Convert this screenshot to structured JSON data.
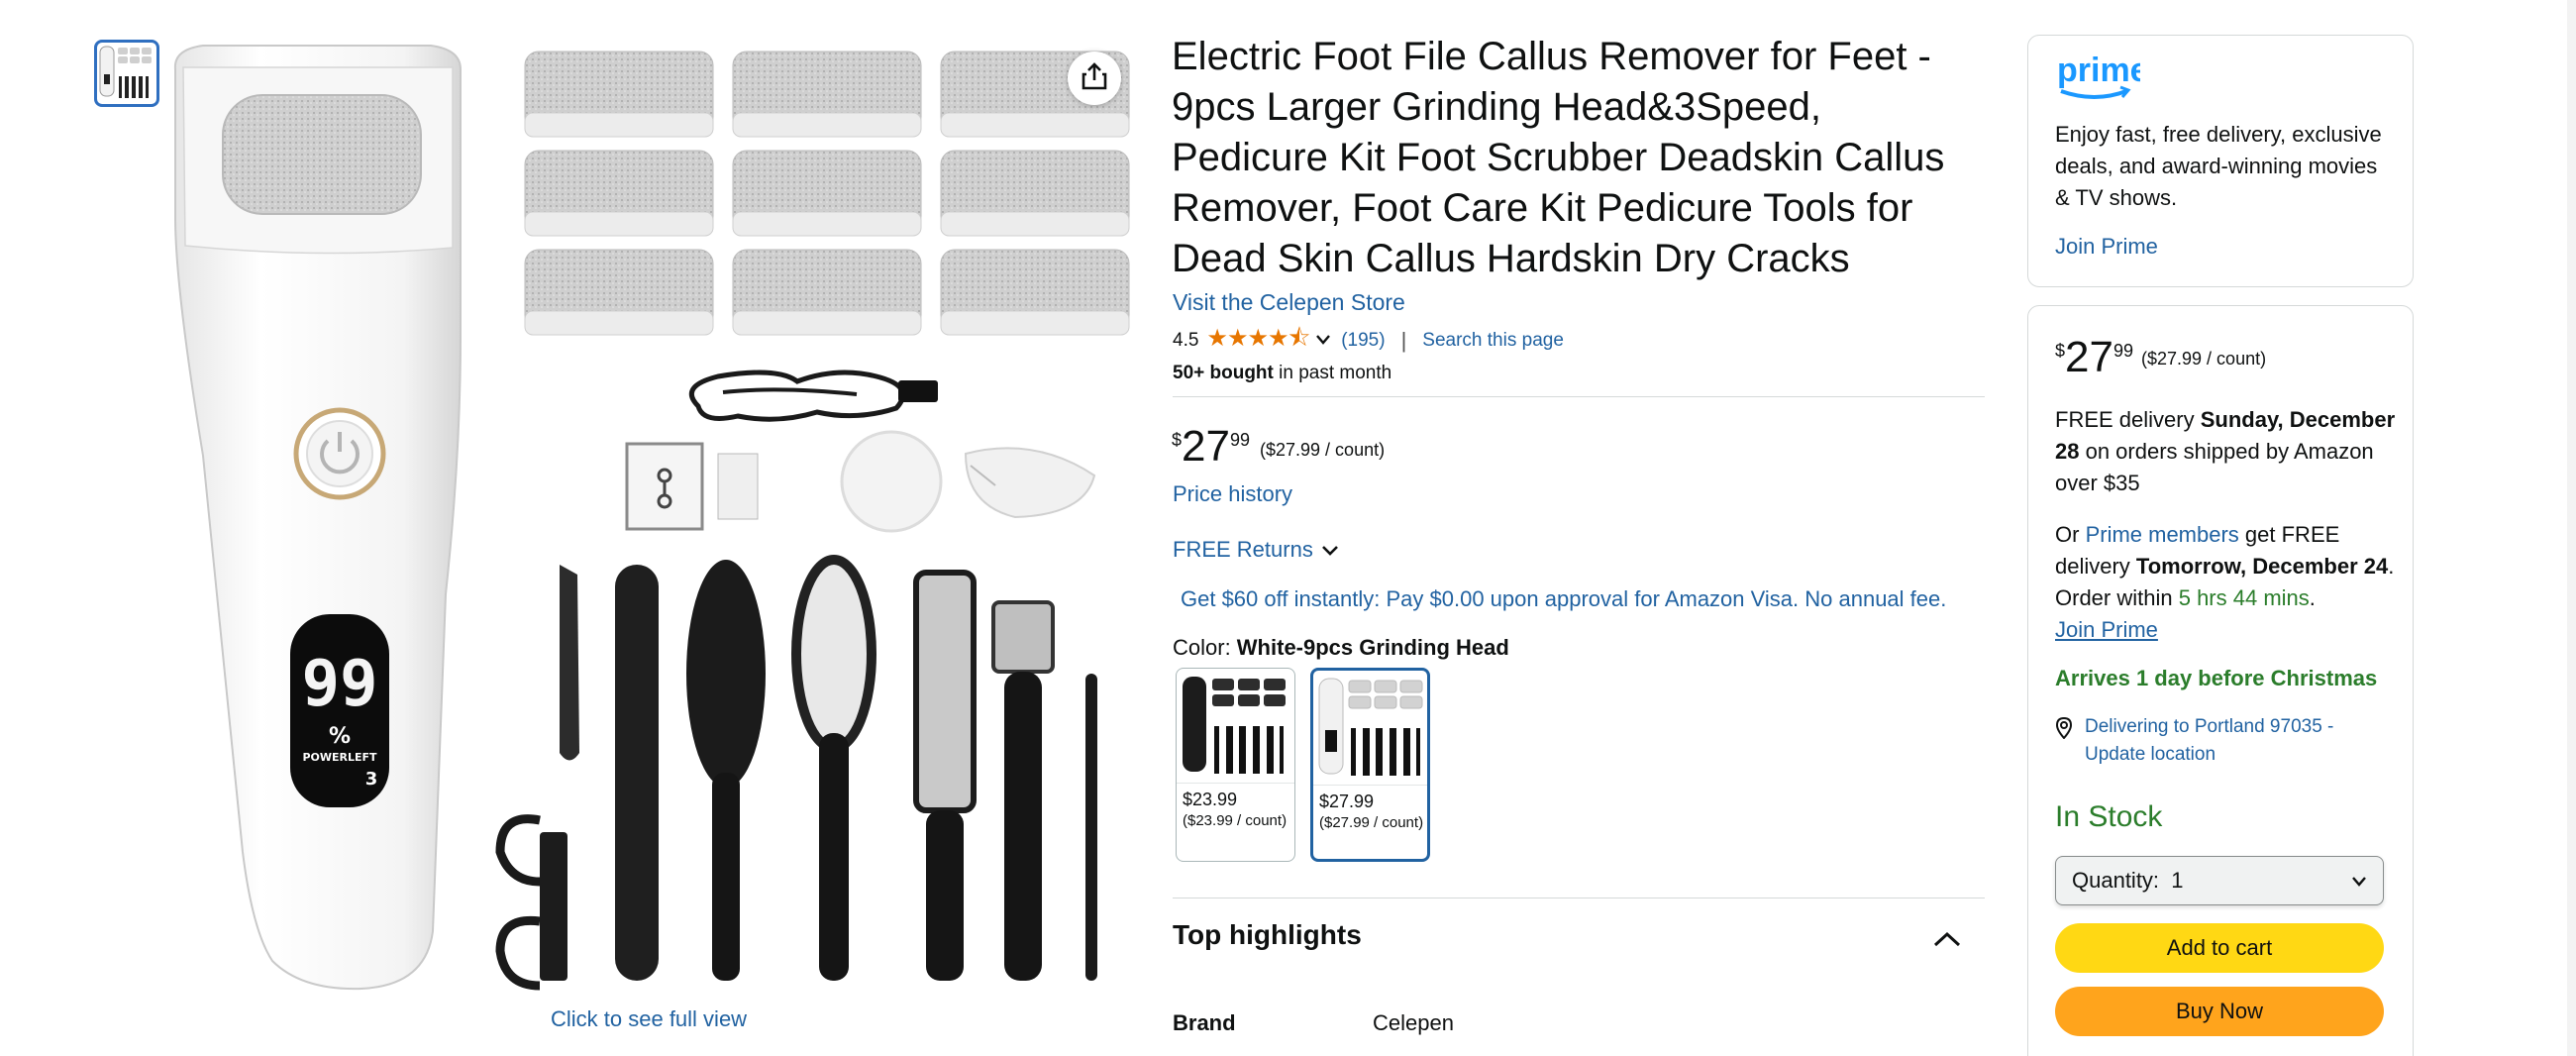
{
  "gallery": {
    "thumbnail_alt": "product-thumbnail",
    "click_full_view": "Click to see full view",
    "display_percent": "99",
    "display_unit": "%",
    "display_label": "POWERLEFT",
    "display_speed": "3"
  },
  "product": {
    "title": "Electric Foot File Callus Remover for Feet - 9pcs Larger Grinding Head&3Speed, Pedicure Kit Foot Scrubber Deadskin Callus Remover, Foot Care Kit Pedicure Tools for Dead Skin Callus Hardskin Dry Cracks",
    "store_link": "Visit the Celepen Store",
    "rating": "4.5",
    "stars": "★★★★⯪",
    "review_count": "(195)",
    "search_page": "Search this page",
    "bought_bold": "50+ bought",
    "bought_rest": " in past month",
    "price_symbol": "$",
    "price_whole": "27",
    "price_fraction": "99",
    "price_unit": "($27.99 / count)",
    "price_history": "Price history",
    "free_returns": "FREE Returns",
    "visa_offer": "Get $60 off instantly: Pay $0.00 upon approval for Amazon Visa. No annual fee.",
    "color_label": "Color: ",
    "color_value": "White-9pcs Grinding Head",
    "swatches": [
      {
        "price": "$23.99",
        "unit": "($23.99 / count)",
        "color": "#1c1c1c"
      },
      {
        "price": "$27.99",
        "unit": "($27.99 / count)",
        "color": "#ffffff"
      }
    ],
    "top_highlights": "Top highlights",
    "brand_label": "Brand",
    "brand_value": "Celepen"
  },
  "prime_box": {
    "logo": "prime",
    "text": "Enjoy fast, free delivery, exclusive deals, and award-winning movies & TV shows.",
    "join": "Join Prime"
  },
  "buy_box": {
    "price_symbol": "$",
    "price_whole": "27",
    "price_fraction": "99",
    "price_unit": "($27.99 / count)",
    "delivery_a": "FREE delivery ",
    "delivery_date": "Sunday, December 28",
    "delivery_b": " on orders shipped by Amazon over $35",
    "or": "Or ",
    "prime_members": "Prime members",
    "get_free": " get FREE delivery ",
    "fast_date": "Tomorrow, December 24",
    "order_within": ". Order within ",
    "countdown": "5 hrs 44 mins",
    "period": ".",
    "join_prime": "Join Prime",
    "christmas": "Arrives 1 day before Christmas",
    "location": "Delivering to Portland 97035 - Update location",
    "in_stock": "In Stock",
    "quantity_label": "Quantity:",
    "quantity_value": "1",
    "add_to_cart": "Add to cart",
    "buy_now": "Buy Now"
  },
  "colors": {
    "link": "#2162a1",
    "green": "#2b7d2b",
    "star": "#e77600",
    "cart_yellow": "#ffd814",
    "buy_orange": "#ffa41c"
  }
}
